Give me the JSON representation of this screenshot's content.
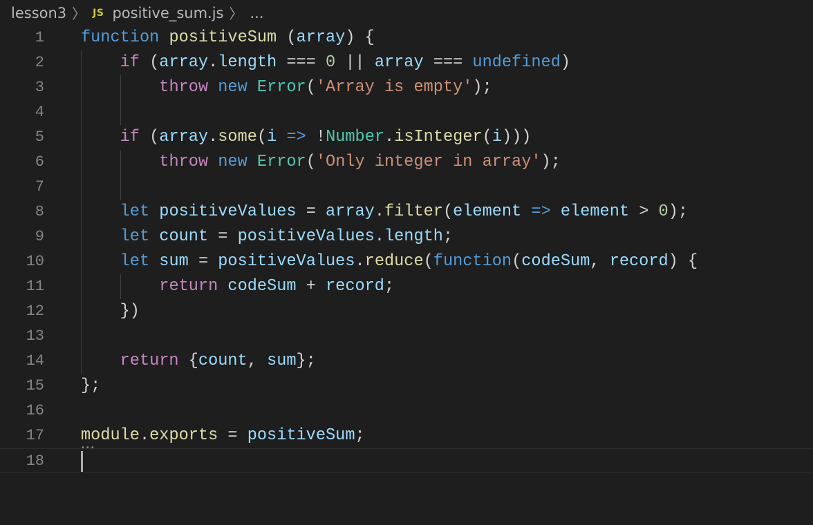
{
  "breadcrumb": {
    "folder": "lesson3",
    "separator": "〉",
    "file_icon": "JS",
    "file": "positive_sum.js",
    "tail": "..."
  },
  "colors": {
    "background": "#1e1e1e",
    "keyword": "#569cd6",
    "control": "#c586c0",
    "function": "#dcdcaa",
    "variable": "#9cdcfe",
    "number": "#b5cea8",
    "string": "#ce9178",
    "type": "#4ec9b0",
    "punctuation": "#d4d4d4",
    "line_number": "#858585"
  },
  "editor": {
    "current_line": 18,
    "lines": [
      {
        "n": "1",
        "tokens": [
          [
            "kw",
            "function"
          ],
          [
            "pun",
            " "
          ],
          [
            "fn",
            "positiveSum"
          ],
          [
            "pun",
            " ("
          ],
          [
            "var",
            "array"
          ],
          [
            "pun",
            ") {"
          ]
        ]
      },
      {
        "n": "2",
        "tokens": [
          [
            "pun",
            "    "
          ],
          [
            "ctl",
            "if"
          ],
          [
            "pun",
            " ("
          ],
          [
            "var",
            "array"
          ],
          [
            "pun",
            "."
          ],
          [
            "var",
            "length"
          ],
          [
            "pun",
            " === "
          ],
          [
            "num",
            "0"
          ],
          [
            "pun",
            " || "
          ],
          [
            "var",
            "array"
          ],
          [
            "pun",
            " === "
          ],
          [
            "kw",
            "undefined"
          ],
          [
            "pun",
            ")"
          ]
        ]
      },
      {
        "n": "3",
        "tokens": [
          [
            "pun",
            "        "
          ],
          [
            "ctl",
            "throw"
          ],
          [
            "pun",
            " "
          ],
          [
            "kw",
            "new"
          ],
          [
            "pun",
            " "
          ],
          [
            "typ",
            "Error"
          ],
          [
            "pun",
            "("
          ],
          [
            "str",
            "'Array is empty'"
          ],
          [
            "pun",
            ");"
          ]
        ]
      },
      {
        "n": "4",
        "tokens": []
      },
      {
        "n": "5",
        "tokens": [
          [
            "pun",
            "    "
          ],
          [
            "ctl",
            "if"
          ],
          [
            "pun",
            " ("
          ],
          [
            "var",
            "array"
          ],
          [
            "pun",
            "."
          ],
          [
            "fn",
            "some"
          ],
          [
            "pun",
            "("
          ],
          [
            "var",
            "i"
          ],
          [
            "pun",
            " "
          ],
          [
            "kw",
            "=>"
          ],
          [
            "pun",
            " !"
          ],
          [
            "typ",
            "Number"
          ],
          [
            "pun",
            "."
          ],
          [
            "fn",
            "isInteger"
          ],
          [
            "pun",
            "("
          ],
          [
            "var",
            "i"
          ],
          [
            "pun",
            ")))"
          ]
        ]
      },
      {
        "n": "6",
        "tokens": [
          [
            "pun",
            "        "
          ],
          [
            "ctl",
            "throw"
          ],
          [
            "pun",
            " "
          ],
          [
            "kw",
            "new"
          ],
          [
            "pun",
            " "
          ],
          [
            "typ",
            "Error"
          ],
          [
            "pun",
            "("
          ],
          [
            "str",
            "'Only integer in array'"
          ],
          [
            "pun",
            ");"
          ]
        ]
      },
      {
        "n": "7",
        "tokens": []
      },
      {
        "n": "8",
        "tokens": [
          [
            "pun",
            "    "
          ],
          [
            "kw",
            "let"
          ],
          [
            "pun",
            " "
          ],
          [
            "var",
            "positiveValues"
          ],
          [
            "pun",
            " = "
          ],
          [
            "var",
            "array"
          ],
          [
            "pun",
            "."
          ],
          [
            "fn",
            "filter"
          ],
          [
            "pun",
            "("
          ],
          [
            "var",
            "element"
          ],
          [
            "pun",
            " "
          ],
          [
            "kw",
            "=>"
          ],
          [
            "pun",
            " "
          ],
          [
            "var",
            "element"
          ],
          [
            "pun",
            " > "
          ],
          [
            "num",
            "0"
          ],
          [
            "pun",
            ");"
          ]
        ]
      },
      {
        "n": "9",
        "tokens": [
          [
            "pun",
            "    "
          ],
          [
            "kw",
            "let"
          ],
          [
            "pun",
            " "
          ],
          [
            "var",
            "count"
          ],
          [
            "pun",
            " = "
          ],
          [
            "var",
            "positiveValues"
          ],
          [
            "pun",
            "."
          ],
          [
            "var",
            "length"
          ],
          [
            "pun",
            ";"
          ]
        ]
      },
      {
        "n": "10",
        "tokens": [
          [
            "pun",
            "    "
          ],
          [
            "kw",
            "let"
          ],
          [
            "pun",
            " "
          ],
          [
            "var",
            "sum"
          ],
          [
            "pun",
            " = "
          ],
          [
            "var",
            "positiveValues"
          ],
          [
            "pun",
            "."
          ],
          [
            "fn",
            "reduce"
          ],
          [
            "pun",
            "("
          ],
          [
            "kw",
            "function"
          ],
          [
            "pun",
            "("
          ],
          [
            "var",
            "codeSum"
          ],
          [
            "pun",
            ", "
          ],
          [
            "var",
            "record"
          ],
          [
            "pun",
            ") {"
          ]
        ]
      },
      {
        "n": "11",
        "tokens": [
          [
            "pun",
            "        "
          ],
          [
            "ctl",
            "return"
          ],
          [
            "pun",
            " "
          ],
          [
            "var",
            "codeSum"
          ],
          [
            "pun",
            " + "
          ],
          [
            "var",
            "record"
          ],
          [
            "pun",
            ";"
          ]
        ]
      },
      {
        "n": "12",
        "tokens": [
          [
            "pun",
            "    })"
          ]
        ]
      },
      {
        "n": "13",
        "tokens": []
      },
      {
        "n": "14",
        "tokens": [
          [
            "pun",
            "    "
          ],
          [
            "ctl",
            "return"
          ],
          [
            "pun",
            " {"
          ],
          [
            "var",
            "count"
          ],
          [
            "pun",
            ", "
          ],
          [
            "var",
            "sum"
          ],
          [
            "pun",
            "};"
          ]
        ]
      },
      {
        "n": "15",
        "tokens": [
          [
            "pun",
            "};"
          ]
        ]
      },
      {
        "n": "16",
        "tokens": []
      },
      {
        "n": "17",
        "tokens": [
          [
            "fn",
            "module"
          ],
          [
            "pun",
            "."
          ],
          [
            "fn",
            "exports"
          ],
          [
            "pun",
            " = "
          ],
          [
            "var",
            "positiveSum"
          ],
          [
            "pun",
            ";"
          ]
        ]
      },
      {
        "n": "18",
        "tokens": []
      }
    ]
  }
}
